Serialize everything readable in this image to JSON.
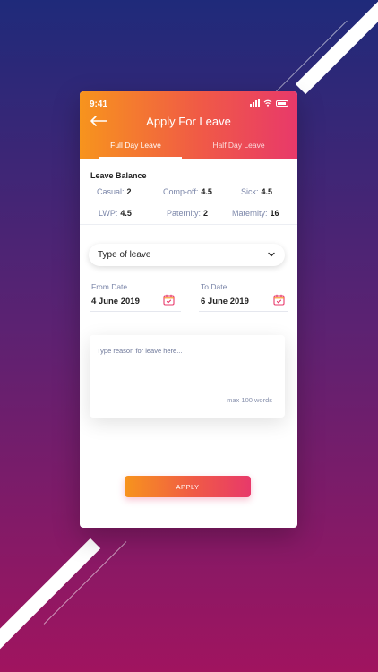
{
  "status": {
    "time": "9:41"
  },
  "header": {
    "title": "Apply For Leave"
  },
  "tabs": [
    {
      "label": "Full Day Leave",
      "active": true
    },
    {
      "label": "Half Day Leave",
      "active": false
    }
  ],
  "balance": {
    "title": "Leave Balance",
    "items": [
      {
        "label": "Casual:",
        "value": "2"
      },
      {
        "label": "Comp-off:",
        "value": "4.5"
      },
      {
        "label": "Sick:",
        "value": "4.5"
      },
      {
        "label": "LWP:",
        "value": "4.5"
      },
      {
        "label": "Paternity:",
        "value": "2"
      },
      {
        "label": "Maternity:",
        "value": "16"
      }
    ]
  },
  "leave_type": {
    "placeholder": "Type of leave"
  },
  "dates": {
    "from_label": "From Date",
    "from_value": "4 June 2019",
    "to_label": "To Date",
    "to_value": "6 June 2019"
  },
  "reason": {
    "placeholder": "Type reason for leave here...",
    "limit": "max 100 words"
  },
  "apply_label": "APPLY",
  "colors": {
    "gradient_start": "#f7941d",
    "gradient_end": "#e8396a",
    "calendar_icon": "#e8396a"
  },
  "icons": [
    "back-arrow-icon",
    "signal-icon",
    "wifi-icon",
    "battery-icon",
    "chevron-down-icon",
    "calendar-icon"
  ]
}
